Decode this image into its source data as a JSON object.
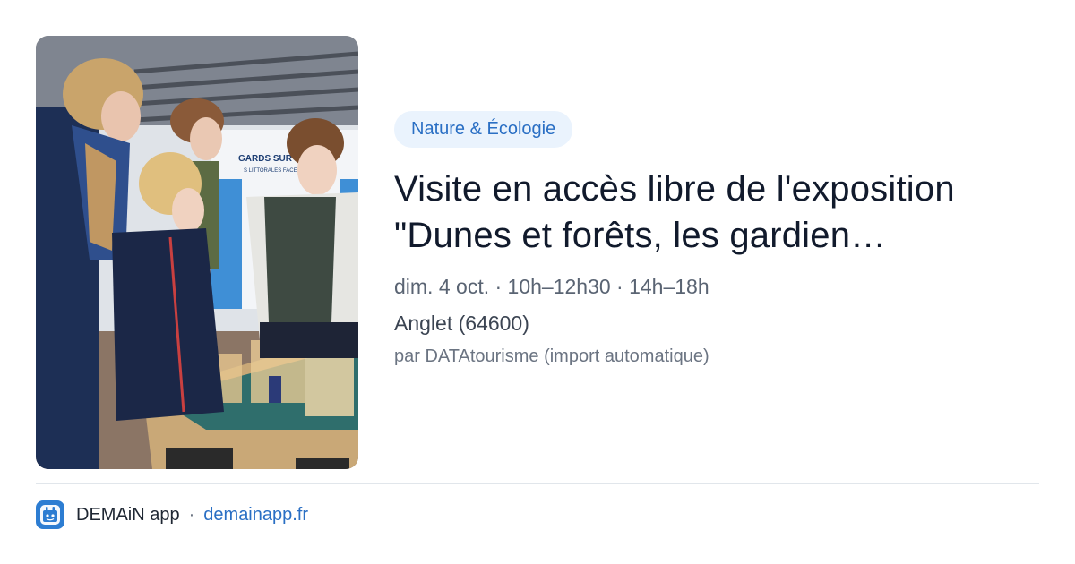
{
  "event": {
    "category": "Nature & Écologie",
    "title_line1": "Visite en accès libre de l'exposition",
    "title_line2": "\"Dunes et forêts, les gardien…",
    "datetime": "dim. 4 oct. · 10h–12h30 · 14h–18h",
    "location": "Anglet (64600)",
    "source": "par DATAtourisme (import automatique)",
    "photo_panel_text": [
      "GARDS SUR L'AV",
      "S LITTORALES FACE À"
    ]
  },
  "footer": {
    "app_name": "DEMAiN app",
    "separator": "·",
    "domain": "demainapp.fr",
    "logo_icon": "demain-app-logo-icon"
  },
  "colors": {
    "accent": "#2a6fc4",
    "tag_background": "#eaf3fd",
    "logo_background": "#2d7dd2"
  }
}
